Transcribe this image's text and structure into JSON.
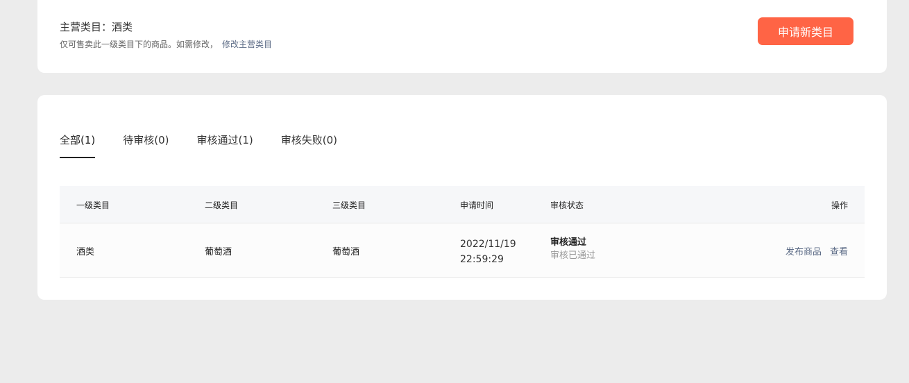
{
  "header": {
    "main_category": "主营类目：酒类",
    "hint": "仅可售卖此一级类目下的商品。如需修改，",
    "modify_link": "修改主营类目",
    "apply_button": "申请新类目"
  },
  "tabs": [
    {
      "label": "全部(1)",
      "active": true
    },
    {
      "label": "待审核(0)",
      "active": false
    },
    {
      "label": "审核通过(1)",
      "active": false
    },
    {
      "label": "审核失败(0)",
      "active": false
    }
  ],
  "table": {
    "columns": [
      "一级类目",
      "二级类目",
      "三级类目",
      "申请时间",
      "审核状态",
      "操作"
    ],
    "rows": [
      {
        "level1": "酒类",
        "level2": "葡萄酒",
        "level3": "葡萄酒",
        "date": "2022/11/19",
        "time": "22:59:29",
        "status": "审核通过",
        "status_detail": "审核已通过",
        "actions": [
          "发布商品",
          "查看"
        ]
      }
    ]
  },
  "colors": {
    "accent": "#ff6445",
    "link": "#5c6b86"
  }
}
